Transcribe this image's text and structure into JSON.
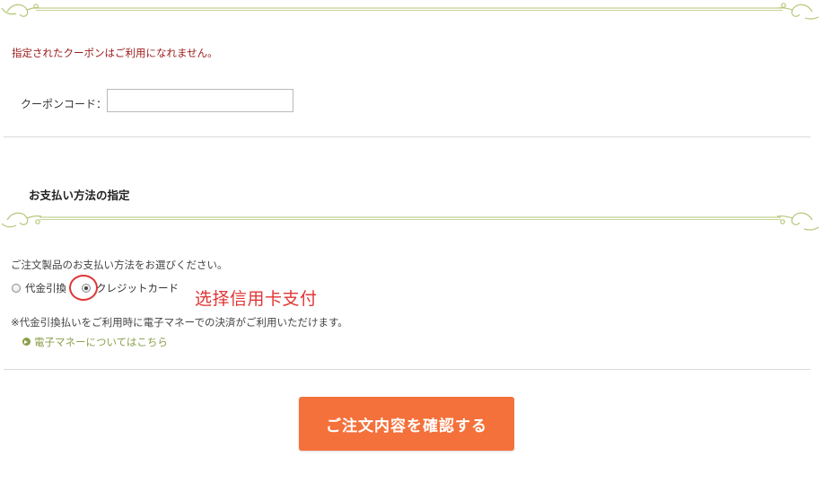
{
  "coupon": {
    "error_message": "指定されたクーポンはご利用になれません。",
    "label": "クーポンコード：",
    "value": "",
    "placeholder": ""
  },
  "payment": {
    "heading": "お支払い方法の指定",
    "intro": "ご注文製品のお支払い方法をお選びください。",
    "options": [
      {
        "label": "代金引換",
        "selected": false
      },
      {
        "label": "クレジットカード",
        "selected": true
      }
    ],
    "note": "※代金引換払いをご利用時に電子マネーでの決済がご利用いただけます。",
    "emoney_link": "電子マネーについてはこちら"
  },
  "annotation": {
    "text": "选择信用卡支付",
    "color": "#e03535"
  },
  "actions": {
    "confirm_label": "ご注文内容を確認する"
  },
  "theme": {
    "accent_orange": "#f4713b",
    "vine_green": "#9eb65a",
    "error_red": "#9b1b1b",
    "link_green": "#8aa04d"
  }
}
